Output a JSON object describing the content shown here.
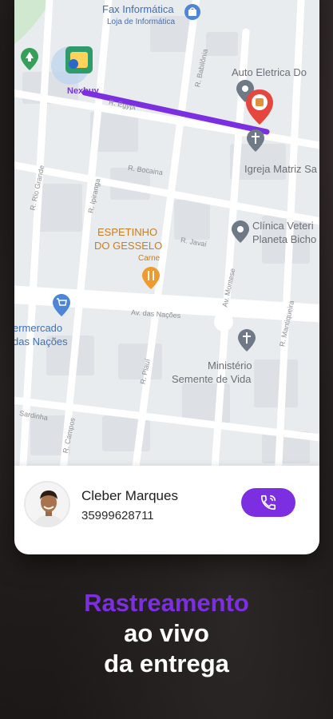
{
  "map": {
    "pois": {
      "fax": "Fax Informática",
      "fax_sub": "Loja de Informática",
      "auto": "Auto Eletrica Do",
      "igreja": "Igreja Matriz Sa",
      "clinica_1": "Clínica Veteri",
      "clinica_2": "Planeta Bicho",
      "espetinho_1": "ESPETINHO",
      "espetinho_2": "DO GESSELO",
      "espetinho_sub": "Carne",
      "mercado_1": "ermercado",
      "mercado_2": "das Nações",
      "ministerio_1": "Ministério",
      "ministerio_2": "Semente de Vida",
      "store": "Nexbuy"
    },
    "streets": {
      "babilonia": "R. Babilônia",
      "bocaina": "R. Bocaina",
      "rio_grande": "R. Rio Grande",
      "ipiranga": "R. Ipiranga",
      "javai": "R. Javaí",
      "montese": "Av. Montese",
      "nacoes": "Av. das Nações",
      "mantiqueira": "R. Mantiqueira",
      "piaui": "R. Piauí",
      "sardinha": "Sardinha",
      "campos": "R. Campos",
      "egypt": "R. Egypt"
    }
  },
  "courier": {
    "name": "Cleber Marques",
    "phone": "35999628711"
  },
  "headline": {
    "line1": "Rastreamento",
    "line2": "ao vivo",
    "line3": "da entrega"
  },
  "colors": {
    "accent": "#7b2fe0",
    "route": "#7b2fe0",
    "pin_red": "#e5473f",
    "store_green": "#2e9c6a"
  },
  "icons": {
    "call": "phone-call-icon",
    "store": "store-icon",
    "destination": "destination-pin-icon",
    "cart": "shopping-cart-icon",
    "food": "fork-knife-icon",
    "church": "cross-icon",
    "park": "tree-icon"
  }
}
